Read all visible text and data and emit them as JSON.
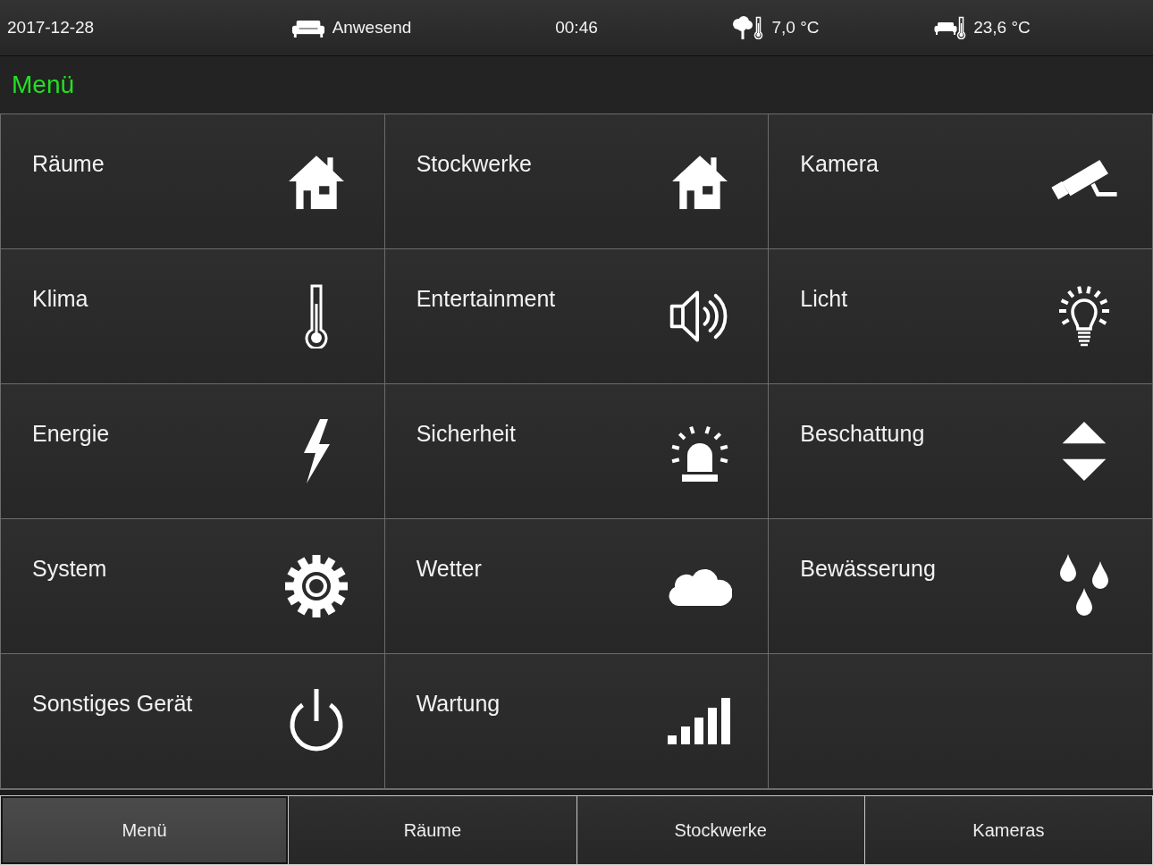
{
  "status_bar": [
    {
      "kind": "date",
      "text": "2017-12-28"
    },
    {
      "kind": "presence",
      "text": "Anwesend"
    },
    {
      "kind": "time",
      "text": "00:46"
    },
    {
      "kind": "outdoor",
      "text": "7,0 °C"
    },
    {
      "kind": "indoor",
      "text": "23,6 °C"
    }
  ],
  "header": {
    "title": "Menü"
  },
  "tiles": [
    {
      "label": "Räume",
      "kind": "house"
    },
    {
      "label": "Stockwerke",
      "kind": "house"
    },
    {
      "label": "Kamera",
      "kind": "camera"
    },
    {
      "label": "Klima",
      "kind": "thermometer"
    },
    {
      "label": "Entertainment",
      "kind": "speaker"
    },
    {
      "label": "Licht",
      "kind": "bulb"
    },
    {
      "label": "Energie",
      "kind": "bolt"
    },
    {
      "label": "Sicherheit",
      "kind": "siren"
    },
    {
      "label": "Beschattung",
      "kind": "updown"
    },
    {
      "label": "System",
      "kind": "gear"
    },
    {
      "label": "Wetter",
      "kind": "cloud"
    },
    {
      "label": "Bewässerung",
      "kind": "drops"
    },
    {
      "label": "Sonstiges Gerät",
      "kind": "power"
    },
    {
      "label": "Wartung",
      "kind": "bars"
    }
  ],
  "tabs": [
    {
      "label": "Menü",
      "selected": true
    },
    {
      "label": "Räume",
      "selected": false
    },
    {
      "label": "Stockwerke",
      "selected": false
    },
    {
      "label": "Kameras",
      "selected": false
    }
  ]
}
